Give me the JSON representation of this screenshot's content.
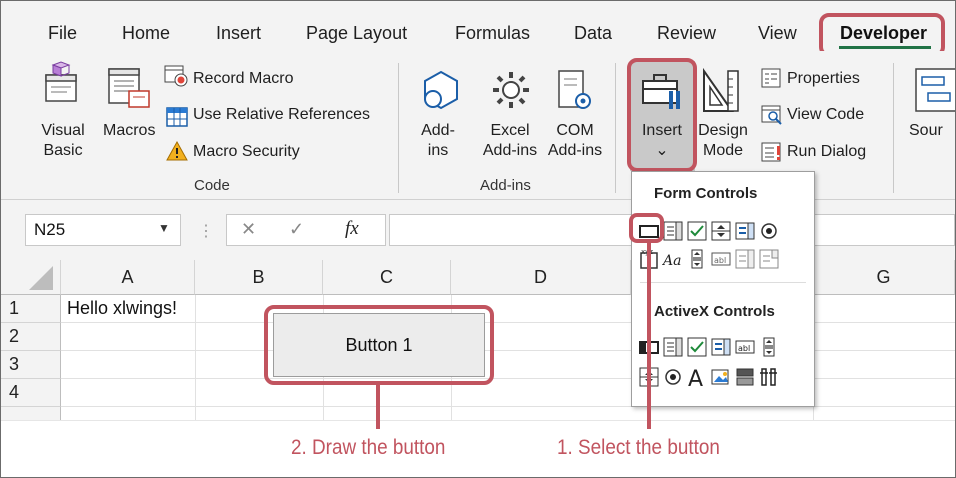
{
  "ribbon_tabs": [
    "File",
    "Home",
    "Insert",
    "Page Layout",
    "Formulas",
    "Data",
    "Review",
    "View",
    "Developer"
  ],
  "code_group": {
    "visual_basic": [
      "Visual",
      "Basic"
    ],
    "macros": "Macros",
    "record_macro": "Record Macro",
    "use_relative": "Use Relative References",
    "macro_security": "Macro Security",
    "label": "Code"
  },
  "addins_group": {
    "addins": [
      "Add-",
      "ins"
    ],
    "excel_addins": [
      "Excel",
      "Add-ins"
    ],
    "com_addins": [
      "COM",
      "Add-ins"
    ],
    "label": "Add-ins"
  },
  "controls_group": {
    "insert": "Insert",
    "insert_chevron": "⌄",
    "design_mode": [
      "Design",
      "Mode"
    ],
    "properties": "Properties",
    "view_code": "View Code",
    "run_dialog": "Run Dialog",
    "source": "Sour"
  },
  "formula_bar": {
    "name_box": "N25",
    "cancel": "✕",
    "enter": "✓",
    "fx": "fx",
    "value": ""
  },
  "columns": [
    "A",
    "B",
    "C",
    "D",
    "G"
  ],
  "rows": [
    "1",
    "2",
    "3",
    "4"
  ],
  "cells": {
    "A1": "Hello xlwings!"
  },
  "button1_label": "Button 1",
  "dropdown": {
    "form_controls": "Form Controls",
    "activex_controls": "ActiveX Controls"
  },
  "annotations": {
    "draw": "2. Draw the button",
    "select": "1. Select the button"
  },
  "accent_color": "#c1545f",
  "developer_underline_color": "#217346"
}
